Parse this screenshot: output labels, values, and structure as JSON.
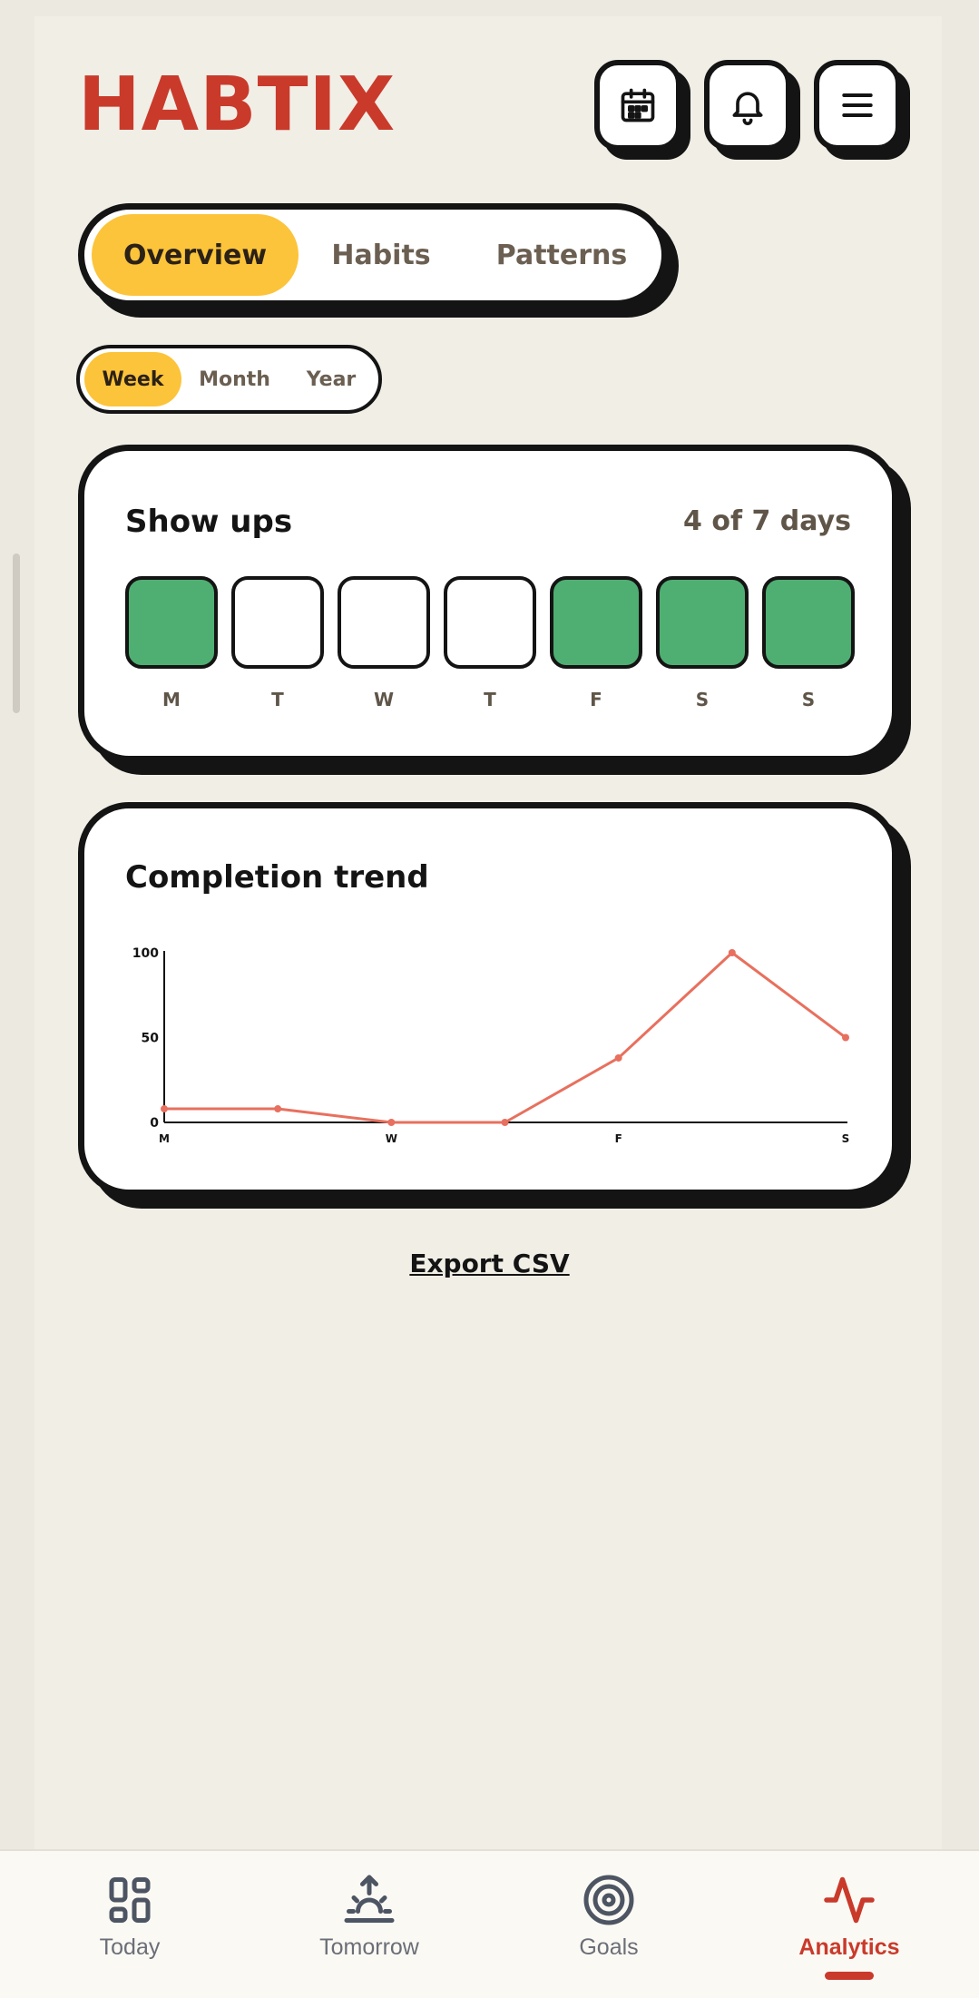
{
  "app": {
    "logo": "HABTIX",
    "accent": "#c93a2b",
    "highlight": "#fcc43a",
    "success": "#4faf72"
  },
  "header": {
    "buttons": [
      {
        "icon": "calendar-icon"
      },
      {
        "icon": "bell-icon"
      },
      {
        "icon": "menu-icon"
      }
    ]
  },
  "tabs": {
    "main": [
      "Overview",
      "Habits",
      "Patterns"
    ],
    "main_selected": "Overview",
    "range": [
      "Week",
      "Month",
      "Year"
    ],
    "range_selected": "Week"
  },
  "show_ups": {
    "title": "Show ups",
    "summary": "4 of 7 days",
    "days": [
      {
        "label": "M",
        "done": true
      },
      {
        "label": "T",
        "done": false
      },
      {
        "label": "W",
        "done": false
      },
      {
        "label": "T",
        "done": false
      },
      {
        "label": "F",
        "done": true
      },
      {
        "label": "S",
        "done": true
      },
      {
        "label": "S",
        "done": true
      }
    ]
  },
  "trend": {
    "title": "Completion trend"
  },
  "chart_data": {
    "type": "line",
    "title": "Completion trend",
    "x": [
      "M",
      "T",
      "W",
      "T",
      "F",
      "S",
      "S"
    ],
    "x_tick_labels": [
      "M",
      "W",
      "F",
      "S"
    ],
    "series": [
      {
        "values": [
          8,
          8,
          0,
          0,
          38,
          100,
          50
        ]
      }
    ],
    "y_ticks": [
      0,
      50,
      100
    ],
    "ylim": [
      0,
      100
    ],
    "color": "#e8705e",
    "grid": false
  },
  "export": {
    "label": "Export CSV"
  },
  "bottom_nav": {
    "items": [
      {
        "label": "Today",
        "icon": "grid-icon"
      },
      {
        "label": "Tomorrow",
        "icon": "sunrise-icon"
      },
      {
        "label": "Goals",
        "icon": "target-icon"
      },
      {
        "label": "Analytics",
        "icon": "activity-icon"
      }
    ],
    "selected": "Analytics"
  }
}
